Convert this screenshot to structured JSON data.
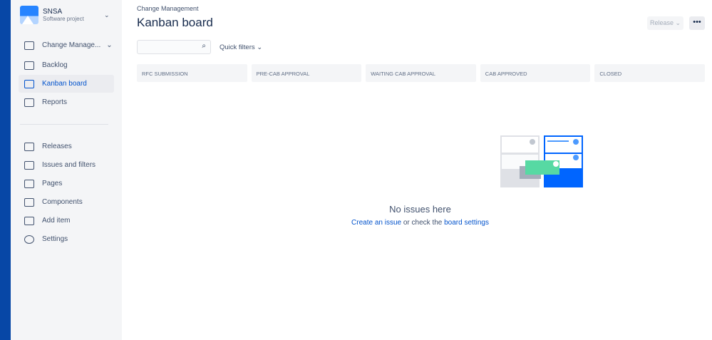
{
  "project": {
    "name": "SNSA",
    "type": "Software project"
  },
  "sidebar": {
    "items": [
      {
        "label": "Change Manage..."
      },
      {
        "label": "Backlog"
      },
      {
        "label": "Kanban board"
      },
      {
        "label": "Reports"
      },
      {
        "label": "Releases"
      },
      {
        "label": "Issues and filters"
      },
      {
        "label": "Pages"
      },
      {
        "label": "Components"
      },
      {
        "label": "Add item"
      },
      {
        "label": "Settings"
      }
    ]
  },
  "header": {
    "breadcrumb": "Change Management",
    "title": "Kanban board",
    "release": "Release ⌄",
    "more": "•••"
  },
  "toolbar": {
    "search_placeholder": "",
    "quick_filters": "Quick filters ⌄"
  },
  "columns": [
    "RFC SUBMISSION",
    "PRE-CAB APPROVAL",
    "WAITING CAB APPROVAL",
    "CAB APPROVED",
    "CLOSED"
  ],
  "empty": {
    "title": "No issues here",
    "create": "Create an issue",
    "middle": " or check the ",
    "settings": "board settings"
  }
}
